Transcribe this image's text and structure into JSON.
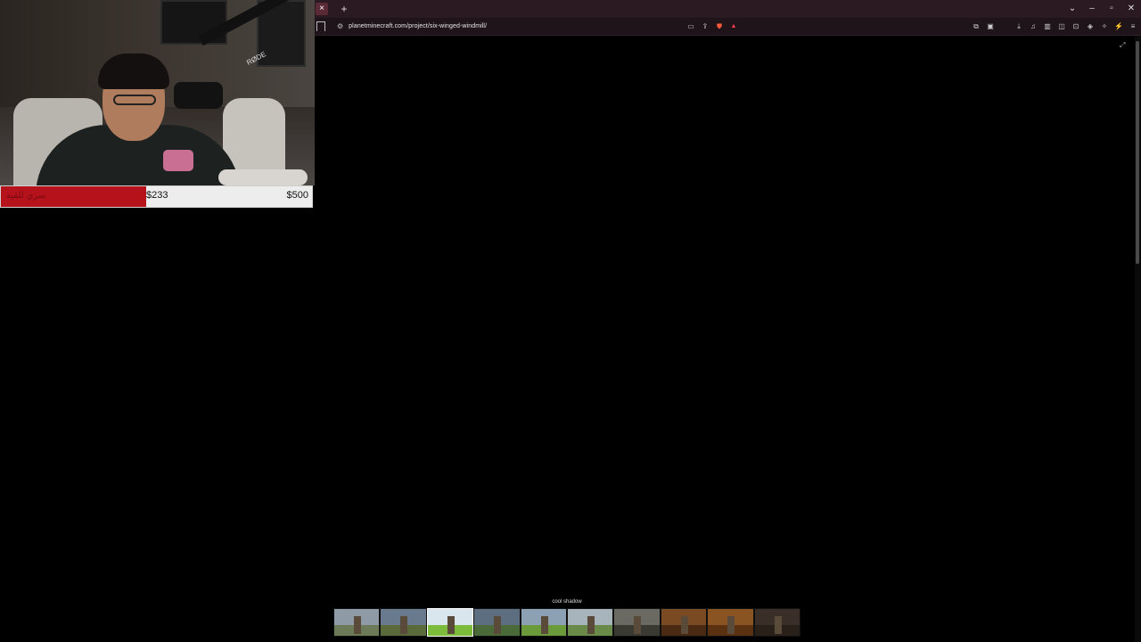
{
  "browser": {
    "tab_close": "×",
    "new_tab": "+",
    "window_controls": [
      "⌄",
      "–",
      "▫",
      "✕"
    ],
    "url": "planetminecraft.com/project/six-winged-windmill/",
    "address_icons": [
      "screen-cast-icon",
      "share-icon",
      "brave-shield-icon",
      "brave-rewards-icon"
    ],
    "toolbar_icons": [
      "extensions-icon",
      "wallet-icon",
      "download-icon",
      "music-icon",
      "sidebar-icon",
      "split-icon",
      "reader-icon",
      "vpn-icon",
      "leo-icon",
      "menu-icon"
    ]
  },
  "webcam": {
    "brand": "RØDE"
  },
  "donation": {
    "label": "سري للقيه",
    "current": "$233",
    "goal": "$500",
    "progress": 0.466,
    "fill_color": "#b5121b"
  },
  "gallery": {
    "tooltip": "cool shadow",
    "active_index": 2,
    "thumbnails": [
      {
        "sky": "#8e9aa6",
        "ground": "#6c7a58"
      },
      {
        "sky": "#6a7a8e",
        "ground": "#5a6a3a"
      },
      {
        "sky": "#d9e6ee",
        "ground": "#7dbb3b"
      },
      {
        "sky": "#5c6e80",
        "ground": "#4a6a3a"
      },
      {
        "sky": "#8ca2b4",
        "ground": "#6a9a3a"
      },
      {
        "sky": "#a8b4bc",
        "ground": "#6a8a4a"
      },
      {
        "sky": "#6a6a62",
        "ground": "#3a3a32"
      },
      {
        "sky": "#7a4a22",
        "ground": "#4a2a12"
      },
      {
        "sky": "#8a5422",
        "ground": "#5a3212"
      },
      {
        "sky": "#3a2e28",
        "ground": "#2a201a"
      }
    ]
  }
}
